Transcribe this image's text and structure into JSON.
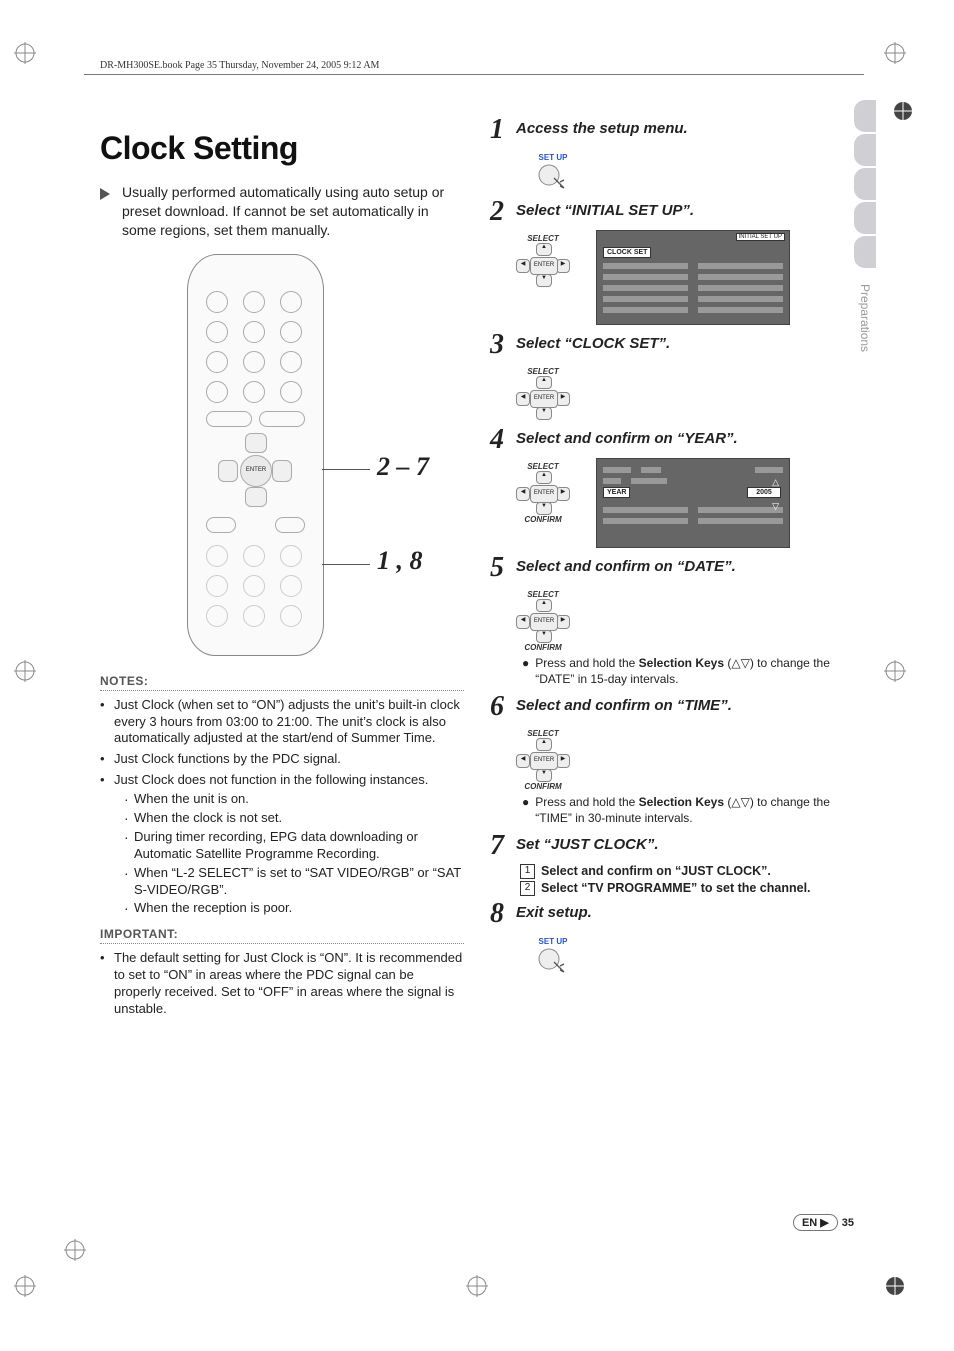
{
  "header_line": "DR-MH300SE.book  Page 35  Thursday, November 24, 2005  9:12 AM",
  "title": "Clock Setting",
  "intro": "Usually performed automatically using auto setup or preset download. If cannot be set automatically in some regions, set them manually.",
  "remote_callouts": {
    "range_top": "2 – 7",
    "range_bottom": "1 , 8"
  },
  "remote_enter_label": "ENTER",
  "notes_label": "NOTES:",
  "notes": [
    "Just Clock (when set to “ON”) adjusts the unit’s built-in clock every 3 hours from 03:00 to 21:00. The unit’s clock is also automatically adjusted at the start/end of Summer Time.",
    "Just Clock functions by the PDC signal.",
    "Just Clock does not function in the following instances."
  ],
  "notes_sub": [
    "When the unit is on.",
    "When the clock is not set.",
    "During timer recording, EPG data downloading or Automatic Satellite Programme Recording.",
    "When “L-2 SELECT” is set to “SAT VIDEO/RGB” or “SAT S-VIDEO/RGB”.",
    "When the reception is poor."
  ],
  "important_label": "IMPORTANT:",
  "important_text": "The default setting for Just Clock is “ON”. It is recommended to set to “ON” in areas where the PDC signal can be properly received. Set to “OFF” in areas where the signal is unstable.",
  "side_tab": "Preparations",
  "pad_label_select": "SELECT",
  "pad_label_confirm": "CONFIRM",
  "pad_enter_label": "ENTER",
  "steps": {
    "s1": {
      "num": "1",
      "title": "Access the setup menu.",
      "setup_label": "SET UP"
    },
    "s2": {
      "num": "2",
      "title": "Select “INITIAL SET UP”.",
      "screen_tab": "INITIAL SET UP",
      "screen_box": "CLOCK SET"
    },
    "s3": {
      "num": "3",
      "title": "Select “CLOCK SET”."
    },
    "s4": {
      "num": "4",
      "title": "Select and confirm on “YEAR”.",
      "year_label": "YEAR",
      "year_value": "2005"
    },
    "s5": {
      "num": "5",
      "title": "Select and confirm on “DATE”.",
      "bullet_a": "Press and hold the ",
      "bullet_b": "Selection Keys",
      "bullet_c": " (△▽) to change the “DATE” in 15-day intervals."
    },
    "s6": {
      "num": "6",
      "title": "Select and confirm on “TIME”.",
      "bullet_a": "Press and hold the ",
      "bullet_b": "Selection Keys",
      "bullet_c": " (△▽) to change the “TIME” in 30-minute intervals."
    },
    "s7": {
      "num": "7",
      "title": "Set “JUST CLOCK”.",
      "sub1": "Select and confirm on “JUST CLOCK”.",
      "sub2a": "Select “",
      "sub2b": "TV PROGRAMME",
      "sub2c": "” to set the channel."
    },
    "s8": {
      "num": "8",
      "title": "Exit setup.",
      "setup_label": "SET UP"
    }
  },
  "footer": {
    "lang": "EN",
    "page": "35"
  }
}
